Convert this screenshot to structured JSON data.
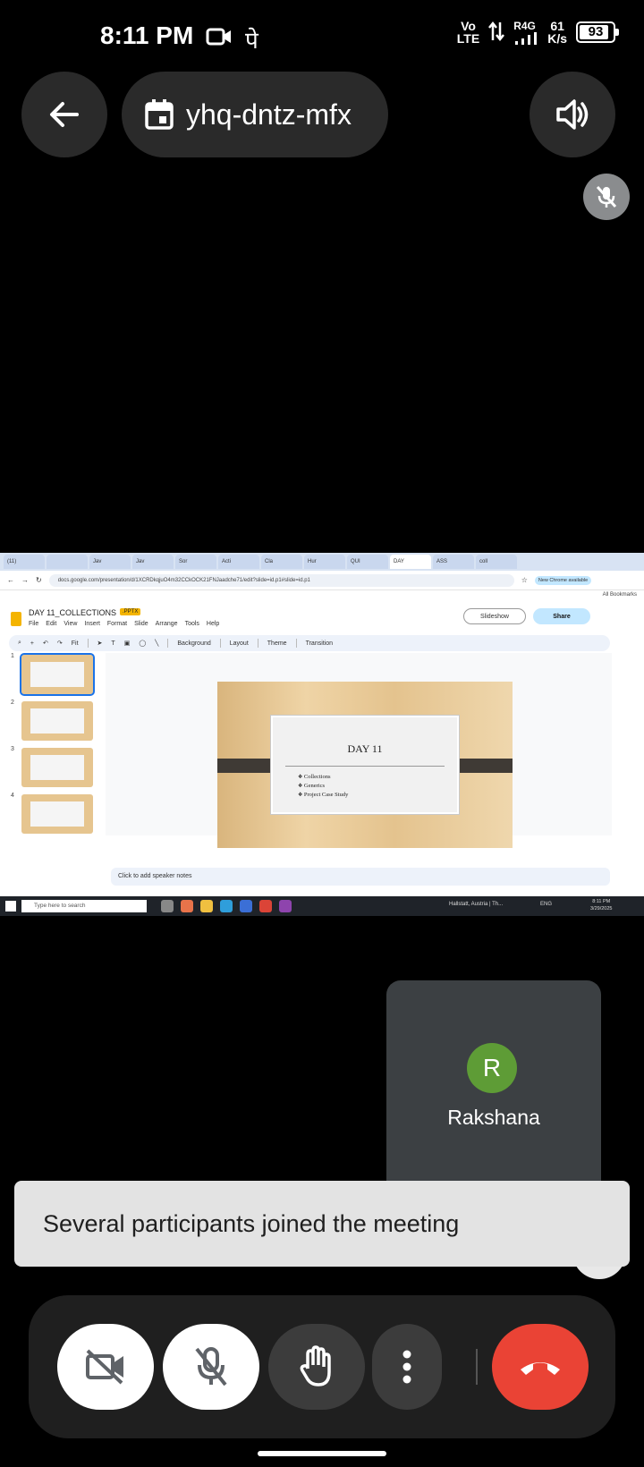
{
  "status_bar": {
    "time": "8:11 PM",
    "carrier_text": "पे",
    "volte_top": "Vo",
    "volte_bottom": "LTE",
    "network_type": "R4G",
    "speed_value": "61",
    "speed_unit": "K/s",
    "battery": "93"
  },
  "meeting": {
    "code": "yhq-dntz-mfx"
  },
  "shared_screen": {
    "tabs": [
      "(11)",
      "",
      "Jav",
      "Jav",
      "Sor",
      "Acti",
      "Cla",
      "Hur",
      "QUI",
      "DAY",
      "ASS",
      "coll"
    ],
    "url": "docs.google.com/presentation/d/1XCRDkqjuO4m32CCkOCK21FNJaadche71/edit?slide=id.p1#slide=id.p1",
    "all_bookmarks": "All Bookmarks",
    "new_chrome": "New Chrome available",
    "doc_title": "DAY 11_COLLECTIONS",
    "file_badge": ".PPTX",
    "menu": [
      "File",
      "Edit",
      "View",
      "Insert",
      "Format",
      "Slide",
      "Arrange",
      "Tools",
      "Help"
    ],
    "slideshow_label": "Slideshow",
    "share_label": "Share",
    "toolbar": {
      "zoom": "Fit",
      "background": "Background",
      "layout": "Layout",
      "theme": "Theme",
      "transition": "Transition"
    },
    "thumb_numbers": [
      "1",
      "2",
      "3",
      "4"
    ],
    "slide": {
      "title": "DAY 11",
      "bullets": [
        "Collections",
        "Generics",
        "Project Case Study"
      ]
    },
    "speaker_notes_placeholder": "Click to add speaker notes",
    "taskbar": {
      "search_placeholder": "Type here to search",
      "news": "Hallstatt, Austria | Th...",
      "tray": "ENG",
      "clock_time": "8:11 PM",
      "clock_date": "3/29/2025"
    }
  },
  "participant": {
    "initial": "R",
    "name": "Rakshana",
    "avatar_color": "#5e9c36"
  },
  "toast": {
    "message": "Several participants joined the meeting"
  },
  "colors": {
    "end_call": "#ea4335",
    "control_bar": "#1f1f1f"
  }
}
